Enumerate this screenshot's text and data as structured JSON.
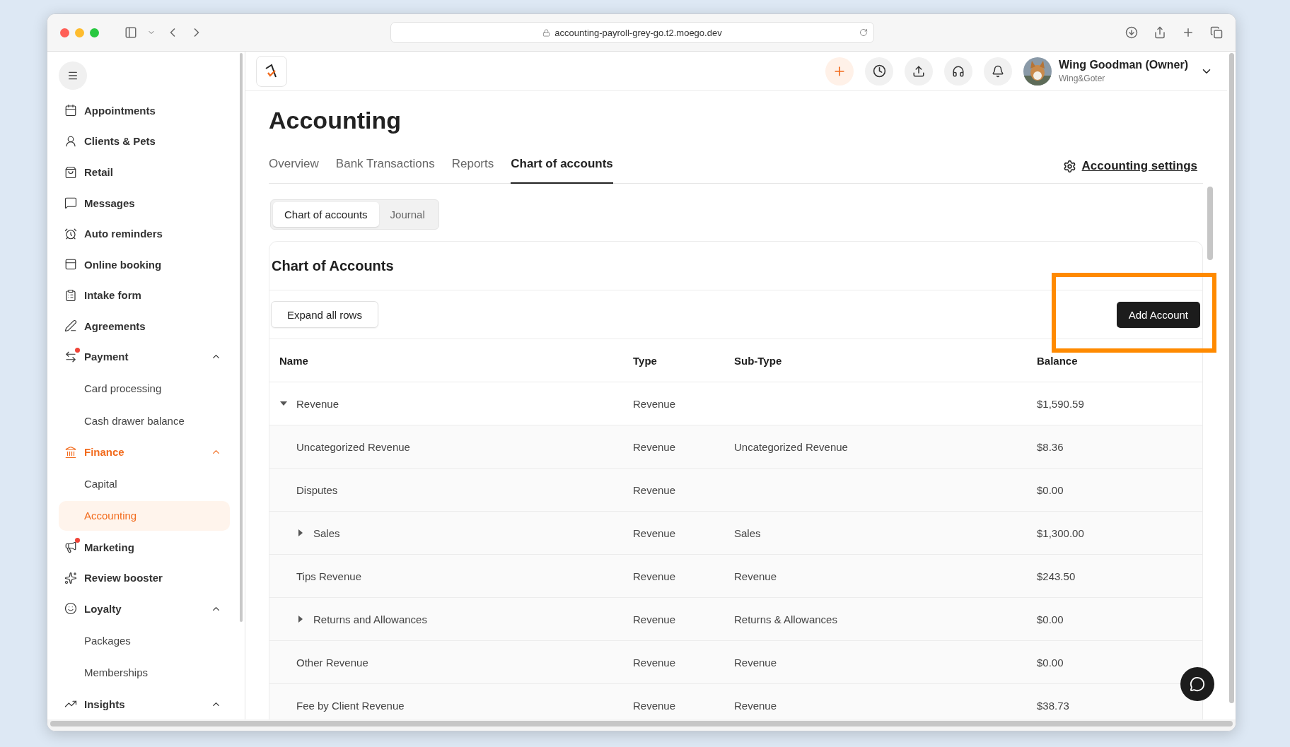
{
  "browser": {
    "url": "accounting-payroll-grey-go.t2.moego.dev"
  },
  "sidebar": {
    "items": [
      {
        "label": "Appointments",
        "selected": false
      },
      {
        "label": "Clients & Pets",
        "selected": false
      },
      {
        "label": "Retail",
        "selected": false
      },
      {
        "label": "Messages",
        "selected": false
      },
      {
        "label": "Auto reminders",
        "selected": false
      },
      {
        "label": "Online booking",
        "selected": false
      },
      {
        "label": "Intake form",
        "selected": false
      },
      {
        "label": "Agreements",
        "selected": false
      },
      {
        "label": "Payment",
        "selected": false,
        "alert": true,
        "expanded": true,
        "children": [
          {
            "label": "Card processing",
            "selected": false
          },
          {
            "label": "Cash drawer balance",
            "selected": false
          }
        ]
      },
      {
        "label": "Finance",
        "selected": true,
        "expanded": true,
        "children": [
          {
            "label": "Capital",
            "selected": false
          },
          {
            "label": "Accounting",
            "selected": true
          }
        ]
      },
      {
        "label": "Marketing",
        "selected": false,
        "alert": true
      },
      {
        "label": "Review booster",
        "selected": false
      },
      {
        "label": "Loyalty",
        "selected": false,
        "expanded": true,
        "children": [
          {
            "label": "Packages",
            "selected": false
          },
          {
            "label": "Memberships",
            "selected": false
          }
        ]
      },
      {
        "label": "Insights",
        "selected": false,
        "expanded": true
      }
    ]
  },
  "header": {
    "user": {
      "name": "Wing Goodman (Owner)",
      "org": "Wing&Goter"
    }
  },
  "page": {
    "title": "Accounting",
    "tabs": [
      {
        "label": "Overview",
        "selected": false
      },
      {
        "label": "Bank Transactions",
        "selected": false
      },
      {
        "label": "Reports",
        "selected": false
      },
      {
        "label": "Chart of accounts",
        "selected": true
      }
    ],
    "settings_link": "Accounting settings",
    "views": [
      {
        "label": "Chart of accounts",
        "selected": true
      },
      {
        "label": "Journal",
        "selected": false
      }
    ],
    "card_title": "Chart of Accounts",
    "expand_button": "Expand all rows",
    "add_button": {
      "label": "Add Account",
      "highlighted": true
    }
  },
  "table": {
    "columns": [
      "Name",
      "Type",
      "Sub-Type",
      "Balance"
    ],
    "rows": [
      {
        "name": "Revenue",
        "type": "Revenue",
        "balance": "$1,590.59",
        "expanded": true,
        "children": [
          {
            "name": "Uncategorized Revenue",
            "type": "Revenue",
            "sub_type": "Uncategorized Revenue",
            "balance": "$8.36"
          },
          {
            "name": "Disputes",
            "type": "Revenue",
            "balance": "$0.00"
          },
          {
            "name": "Sales",
            "type": "Revenue",
            "sub_type": "Sales",
            "balance": "$1,300.00",
            "expanded": false
          },
          {
            "name": "Tips Revenue",
            "type": "Revenue",
            "sub_type": "Revenue",
            "balance": "$243.50"
          },
          {
            "name": "Returns and Allowances",
            "type": "Revenue",
            "sub_type": "Returns & Allowances",
            "balance": "$0.00",
            "expanded": false
          },
          {
            "name": "Other Revenue",
            "type": "Revenue",
            "sub_type": "Revenue",
            "balance": "$0.00"
          },
          {
            "name": "Fee by Client Revenue",
            "type": "Revenue",
            "sub_type": "Revenue",
            "balance": "$38.73"
          }
        ]
      }
    ]
  }
}
